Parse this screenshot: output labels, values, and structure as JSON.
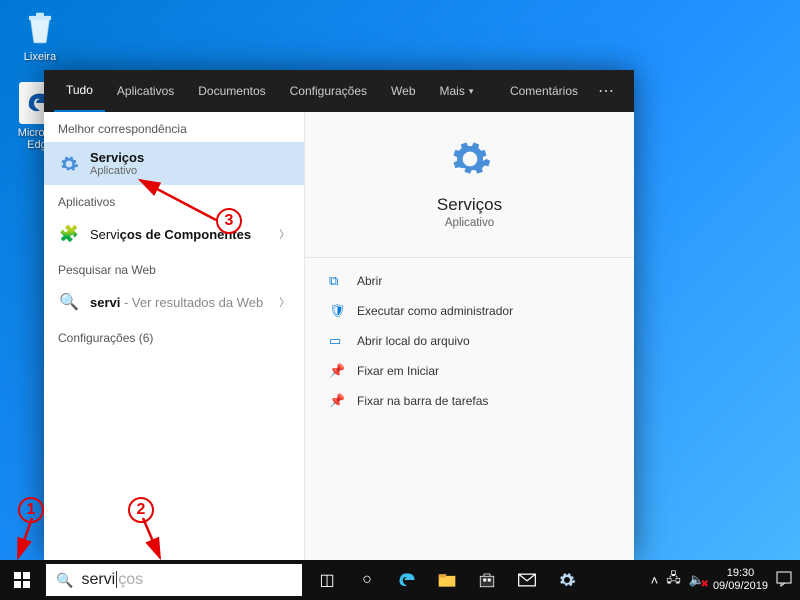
{
  "desktop": {
    "icons": [
      {
        "name": "recycle-bin",
        "label": "Lixeira"
      },
      {
        "name": "edge",
        "label": "Microsoft Edge"
      }
    ]
  },
  "search": {
    "tabs": {
      "all": "Tudo",
      "apps": "Aplicativos",
      "docs": "Documentos",
      "settings": "Configurações",
      "web": "Web",
      "more": "Mais",
      "feedback": "Comentários"
    },
    "sections": {
      "best_match": "Melhor correspondência",
      "apps": "Aplicativos",
      "search_web": "Pesquisar na Web",
      "settings_count": "Configurações (6)"
    },
    "best": {
      "title": "Serviços",
      "subtitle": "Aplicativo"
    },
    "app_result": {
      "prefix": "Servi",
      "bold": "ços de Componentes"
    },
    "web_result": {
      "prefix": "servi",
      "suffix": " - Ver resultados da Web"
    },
    "preview": {
      "title": "Serviços",
      "subtitle": "Aplicativo"
    },
    "actions": {
      "open": "Abrir",
      "run_admin": "Executar como administrador",
      "open_location": "Abrir local do arquivo",
      "pin_start": "Fixar em Iniciar",
      "pin_taskbar": "Fixar na barra de tarefas"
    },
    "input": {
      "typed": "servi",
      "suggestion_tail": "ços"
    }
  },
  "tray": {
    "time": "19:30",
    "date": "09/09/2019"
  },
  "annotations": {
    "n1": "1",
    "n2": "2",
    "n3": "3"
  }
}
